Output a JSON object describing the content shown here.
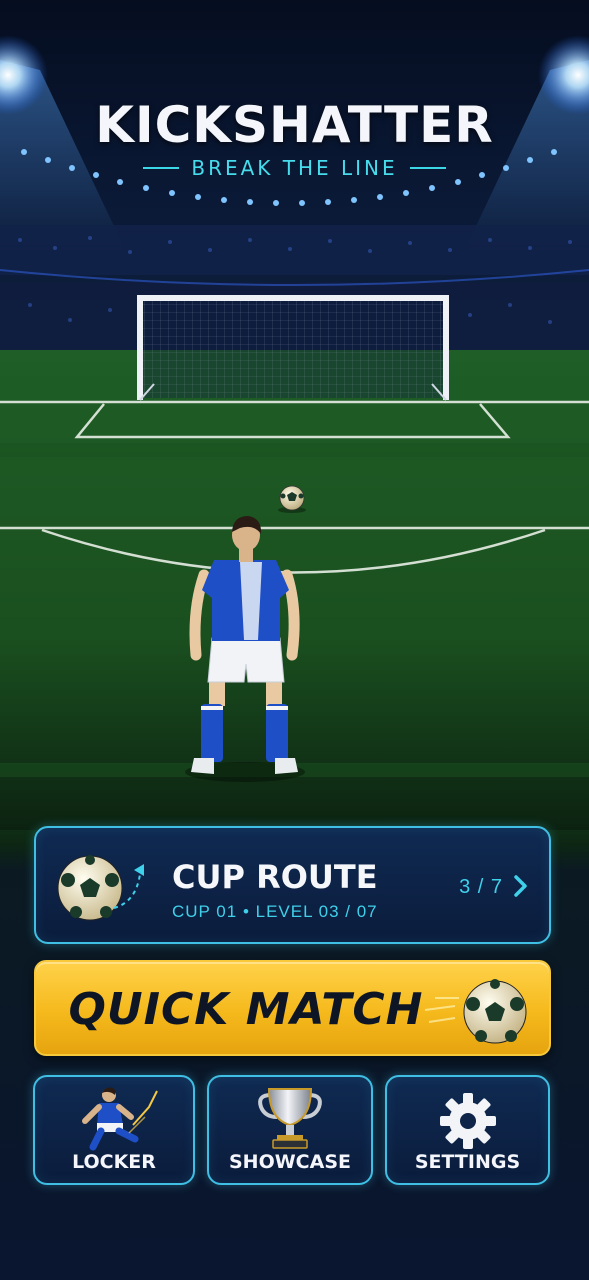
{
  "header": {
    "title": "KICKSHATTER",
    "subtitle": "BREAK THE LINE"
  },
  "cup_route": {
    "title": "CUP ROUTE",
    "detail": "CUP 01 • LEVEL 03 / 07",
    "progress_text": "3 / 7",
    "progress_fraction": 0.4286,
    "icons": [
      "soccer-ball-icon",
      "chevron-right-icon"
    ]
  },
  "quick_match": {
    "label": "QUICK MATCH",
    "icon": "soccer-ball-icon"
  },
  "tiles": [
    {
      "label": "LOCKER",
      "icon": "player-kick-icon"
    },
    {
      "label": "SHOWCASE",
      "icon": "trophy-icon"
    },
    {
      "label": "SETTINGS",
      "icon": "gear-icon"
    }
  ],
  "colors": {
    "accent_cyan": "#3fbfe3",
    "button_yellow": "#f5b91c",
    "jersey_blue": "#1f4fc6"
  }
}
